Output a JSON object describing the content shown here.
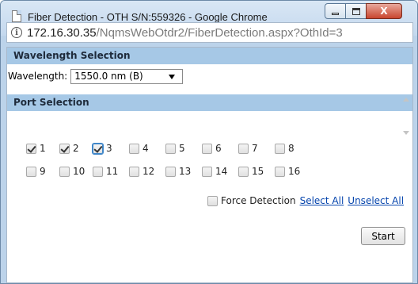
{
  "window": {
    "title": "Fiber Detection - OTH S/N:559326 - Google Chrome",
    "controls": {
      "close_label": "X"
    }
  },
  "address": {
    "host": "172.16.30.35",
    "path": "/NqmsWebOtdr2/FiberDetection.aspx?OthId=3"
  },
  "wavelength": {
    "header": "Wavelength Selection",
    "label": "Wavelength:",
    "selected": "1550.0 nm (B)"
  },
  "ports": {
    "header": "Port Selection",
    "items": [
      {
        "label": "1",
        "checked": true
      },
      {
        "label": "2",
        "checked": true
      },
      {
        "label": "3",
        "checked": true
      },
      {
        "label": "4",
        "checked": false
      },
      {
        "label": "5",
        "checked": false
      },
      {
        "label": "6",
        "checked": false
      },
      {
        "label": "7",
        "checked": false
      },
      {
        "label": "8",
        "checked": false
      },
      {
        "label": "9",
        "checked": false
      },
      {
        "label": "10",
        "checked": false
      },
      {
        "label": "11",
        "checked": false
      },
      {
        "label": "12",
        "checked": false
      },
      {
        "label": "13",
        "checked": false
      },
      {
        "label": "14",
        "checked": false
      },
      {
        "label": "15",
        "checked": false
      },
      {
        "label": "16",
        "checked": false
      }
    ]
  },
  "actions": {
    "force_label": "Force Detection",
    "select_all": "Select All",
    "unselect_all": "Unselect All",
    "start": "Start"
  }
}
